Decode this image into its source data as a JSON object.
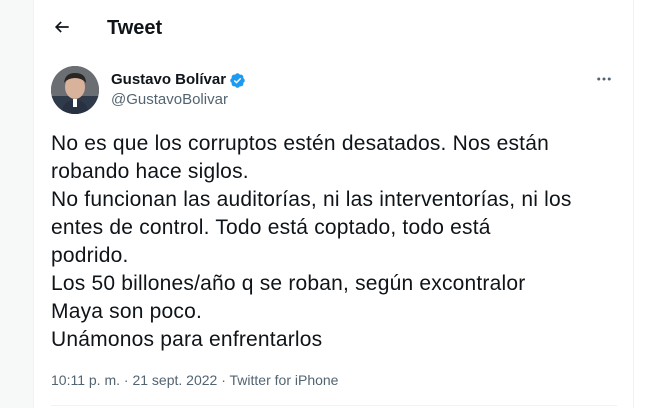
{
  "header": {
    "title": "Tweet",
    "back_icon": "arrow-left-icon"
  },
  "author": {
    "display_name": "Gustavo Bolívar",
    "handle": "@GustavoBolivar",
    "verified": true,
    "verified_color": "#1d9bf0",
    "more_icon": "more-horizontal-icon"
  },
  "tweet": {
    "lines": [
      "No es que los corruptos estén desatados. Nos están",
      "robando hace siglos.",
      "No funcionan las auditorías, ni las interventorías, ni los",
      "entes de control. Todo está coptado, todo está",
      "podrido.",
      "Los 50 billones/año q se roban, según excontralor",
      "Maya son poco.",
      "Unámonos para enfrentarlos"
    ]
  },
  "meta": {
    "time": "10:11 p. m.",
    "date": "21 sept. 2022",
    "source": "Twitter for iPhone",
    "separator": "·"
  },
  "colors": {
    "text_primary": "#0f1419",
    "text_secondary": "#536471",
    "border": "#eff3f4"
  }
}
